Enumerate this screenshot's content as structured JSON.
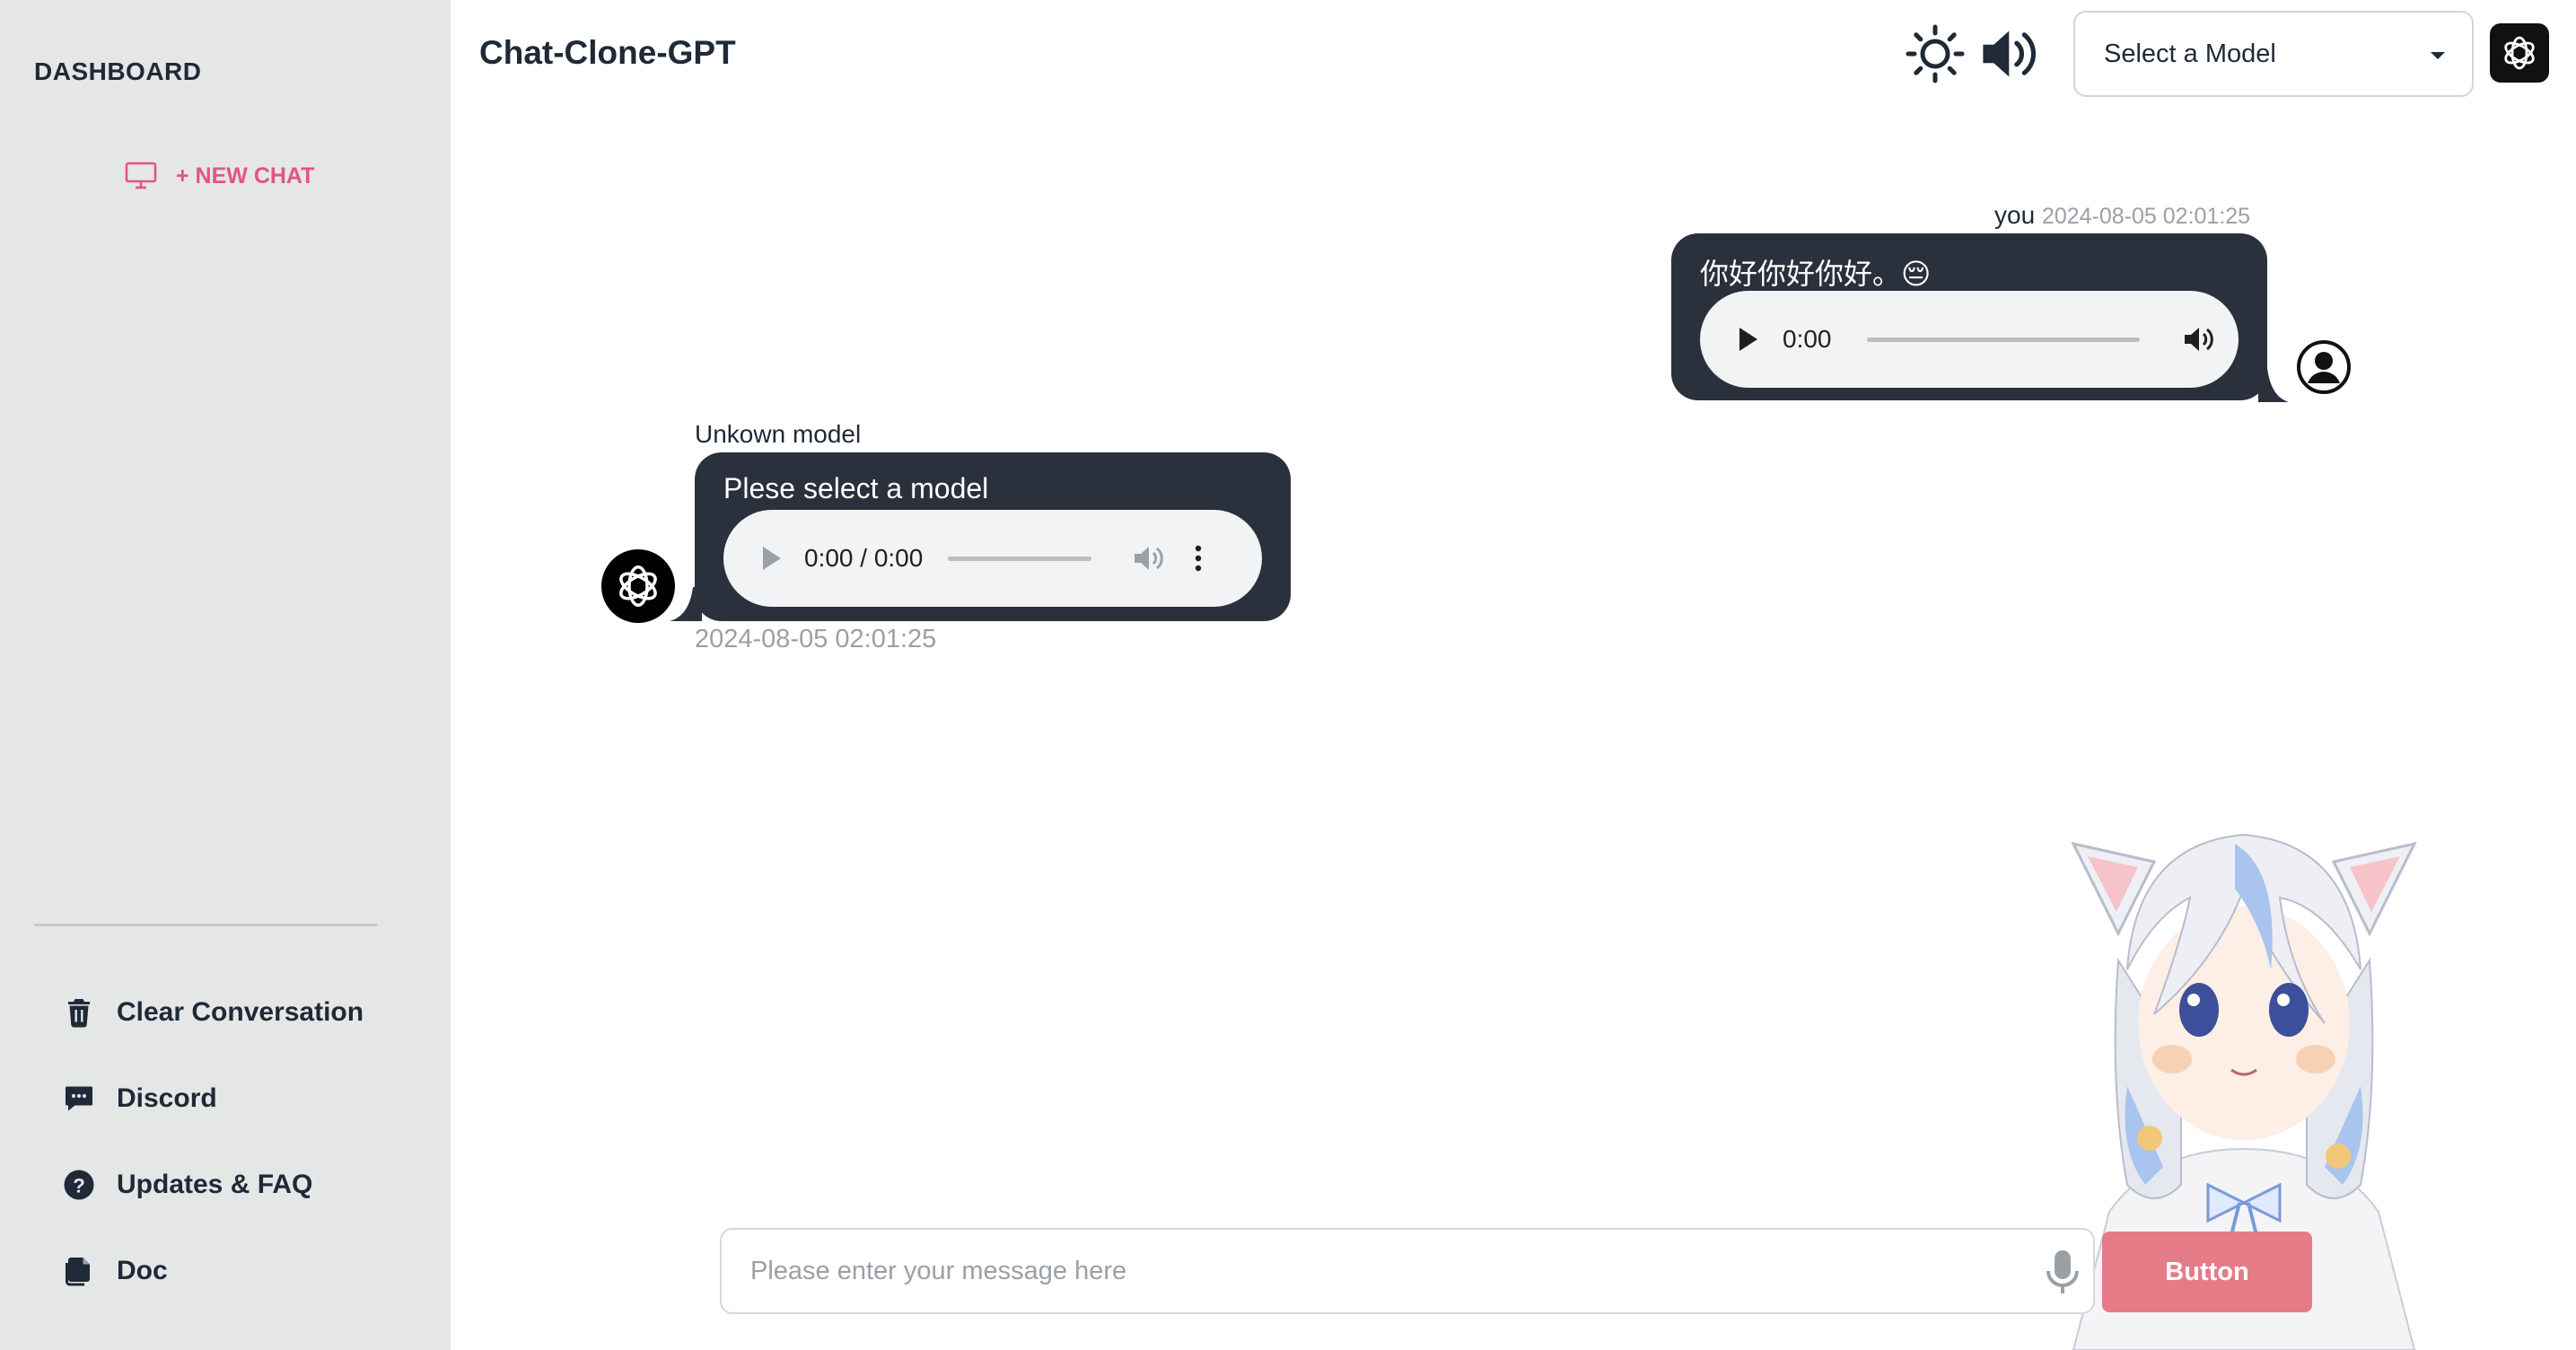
{
  "sidebar": {
    "title": "DASHBOARD",
    "new_chat_label": "+ NEW CHAT",
    "menu": [
      {
        "label": "Clear Conversation",
        "icon": "trash-icon"
      },
      {
        "label": "Discord",
        "icon": "chat-bubble-icon"
      },
      {
        "label": "Updates & FAQ",
        "icon": "question-circle-icon"
      },
      {
        "label": "Doc",
        "icon": "documents-icon"
      }
    ]
  },
  "header": {
    "title": "Chat-Clone-GPT",
    "model_select": {
      "selected": "Select a Model"
    }
  },
  "messages": [
    {
      "role": "user",
      "sender": "you",
      "timestamp": "2024-08-05 02:01:25",
      "text": "你好你好你好。😔",
      "audio_time": "0:00"
    },
    {
      "role": "assistant",
      "sender": "Unkown model",
      "timestamp": "2024-08-05 02:01:25",
      "text": "Plese select a model",
      "audio_time": "0:00 / 0:00"
    }
  ],
  "composer": {
    "placeholder": "Please enter your message here",
    "button_label": "Button"
  },
  "colors": {
    "accent": "#e2567e",
    "bubble": "#2a303c",
    "sidebar_bg": "#e5e6e6",
    "send_button": "#e57b86"
  }
}
